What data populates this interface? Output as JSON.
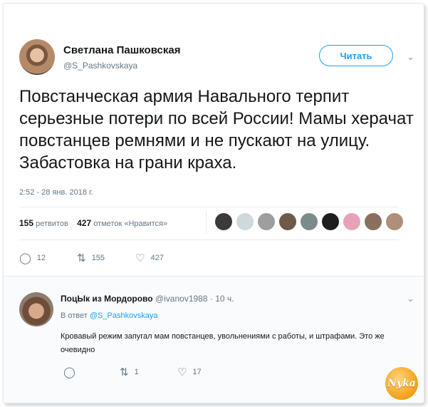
{
  "tweet": {
    "author_name": "Светлана Пашковская",
    "author_handle": "@S_Pashkovskaya",
    "follow_label": "Читать",
    "text": "Повстанческая армия Навального терпит серьезные потери по всей России! Мамы херачат повстанцев ремнями и не пускают на улицу. Забастовка на грани краха.",
    "timestamp": "2:52 - 28 янв. 2018 г.",
    "retweets_count": "155",
    "retweets_label": "ретвитов",
    "likes_count": "427",
    "likes_label": "отметок «Нравится»",
    "actions": {
      "reply_count": "12",
      "retweet_count": "155",
      "like_count": "427"
    }
  },
  "reply": {
    "author_name": "ПоцЫк из Мордорово",
    "author_handle": "@ivanov1988",
    "time": "· 10 ч.",
    "reply_to_prefix": "В ответ",
    "reply_to_handle": "@S_Pashkovskaya",
    "text": "Кровавый режим запугал мам повстанцев, увольнениями с работы, и штрафами. Это же очевидно",
    "actions": {
      "retweet_count": "1",
      "like_count": "17"
    }
  },
  "watermark": {
    "text": "Nyka"
  },
  "colors": {
    "accent": "#1da1f2",
    "muted": "#657786"
  }
}
